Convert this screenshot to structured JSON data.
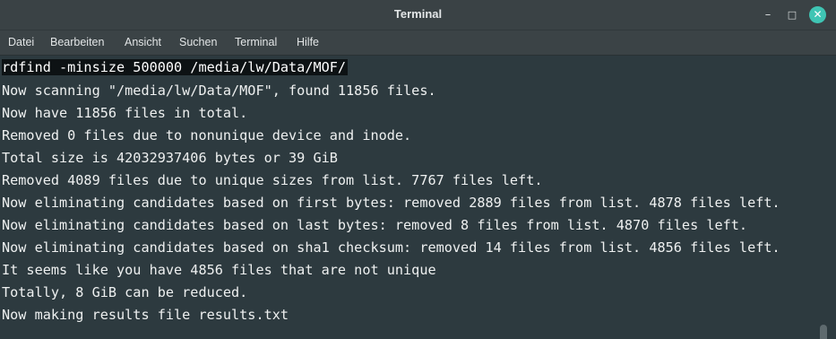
{
  "window": {
    "title": "Terminal",
    "minimize_icon": "minimize-icon",
    "maximize_icon": "maximize-icon",
    "close_icon": "close-icon",
    "close_color": "#3fc5b4"
  },
  "menu": {
    "items": [
      "Datei",
      "Bearbeiten",
      "Ansicht",
      "Suchen",
      "Terminal",
      "Hilfe"
    ]
  },
  "terminal": {
    "command": "rdfind -minsize 500000 /media/lw/Data/MOF/",
    "output": [
      "Now scanning \"/media/lw/Data/MOF\", found 11856 files.",
      "Now have 11856 files in total.",
      "Removed 0 files due to nonunique device and inode.",
      "Total size is 42032937406 bytes or 39 GiB",
      "Removed 4089 files due to unique sizes from list. 7767 files left.",
      "Now eliminating candidates based on first bytes: removed 2889 files from list. 4878 files left.",
      "Now eliminating candidates based on last bytes: removed 8 files from list. 4870 files left.",
      "Now eliminating candidates based on sha1 checksum: removed 14 files from list. 4856 files left.",
      "It seems like you have 4856 files that are not unique",
      "Totally, 8 GiB can be reduced.",
      "Now making results file results.txt"
    ]
  }
}
